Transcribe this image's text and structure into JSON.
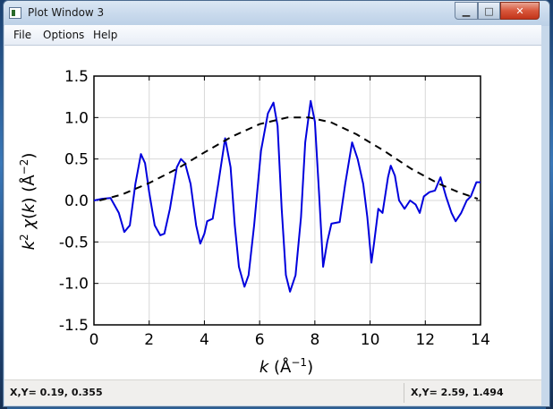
{
  "window": {
    "title": "Plot Window 3",
    "buttons": {
      "minimize": "▁",
      "maximize": "□",
      "close": "✕"
    }
  },
  "menu": [
    "File",
    "Options",
    "Help"
  ],
  "status": {
    "left": "X,Y= 0.19, 0.355",
    "right": "X,Y= 2.59, 1.494"
  },
  "chart_data": {
    "type": "line",
    "xlabel": "k (Å⁻¹)",
    "ylabel": "k² χ(k) (Å⁻²)",
    "xlim": [
      0,
      14
    ],
    "ylim": [
      -1.5,
      1.5
    ],
    "x_ticks": [
      "0",
      "2",
      "4",
      "6",
      "8",
      "10",
      "12",
      "14"
    ],
    "y_ticks": [
      "-1.5",
      "-1.0",
      "-0.5",
      "0.0",
      "0.5",
      "1.0",
      "1.5"
    ],
    "grid": true,
    "series": [
      {
        "style": "solid",
        "color": "#0000dd",
        "points": [
          [
            0.0,
            0.0
          ],
          [
            0.3,
            0.02
          ],
          [
            0.6,
            0.03
          ],
          [
            0.9,
            -0.15
          ],
          [
            1.1,
            -0.38
          ],
          [
            1.3,
            -0.3
          ],
          [
            1.5,
            0.2
          ],
          [
            1.7,
            0.56
          ],
          [
            1.85,
            0.45
          ],
          [
            2.0,
            0.1
          ],
          [
            2.2,
            -0.3
          ],
          [
            2.4,
            -0.42
          ],
          [
            2.55,
            -0.4
          ],
          [
            2.75,
            -0.1
          ],
          [
            3.0,
            0.4
          ],
          [
            3.15,
            0.5
          ],
          [
            3.3,
            0.45
          ],
          [
            3.5,
            0.2
          ],
          [
            3.7,
            -0.3
          ],
          [
            3.85,
            -0.52
          ],
          [
            4.0,
            -0.4
          ],
          [
            4.1,
            -0.25
          ],
          [
            4.3,
            -0.22
          ],
          [
            4.5,
            0.2
          ],
          [
            4.75,
            0.75
          ],
          [
            4.95,
            0.4
          ],
          [
            5.1,
            -0.3
          ],
          [
            5.25,
            -0.8
          ],
          [
            5.45,
            -1.04
          ],
          [
            5.6,
            -0.9
          ],
          [
            5.8,
            -0.3
          ],
          [
            6.05,
            0.6
          ],
          [
            6.3,
            1.05
          ],
          [
            6.5,
            1.18
          ],
          [
            6.65,
            0.9
          ],
          [
            6.8,
            -0.1
          ],
          [
            6.95,
            -0.9
          ],
          [
            7.1,
            -1.1
          ],
          [
            7.3,
            -0.9
          ],
          [
            7.5,
            -0.2
          ],
          [
            7.65,
            0.7
          ],
          [
            7.85,
            1.2
          ],
          [
            8.0,
            0.95
          ],
          [
            8.15,
            0.1
          ],
          [
            8.3,
            -0.8
          ],
          [
            8.45,
            -0.5
          ],
          [
            8.6,
            -0.28
          ],
          [
            8.9,
            -0.26
          ],
          [
            9.1,
            0.2
          ],
          [
            9.35,
            0.7
          ],
          [
            9.55,
            0.5
          ],
          [
            9.75,
            0.2
          ],
          [
            9.9,
            -0.2
          ],
          [
            10.05,
            -0.75
          ],
          [
            10.15,
            -0.5
          ],
          [
            10.3,
            -0.1
          ],
          [
            10.45,
            -0.15
          ],
          [
            10.65,
            0.28
          ],
          [
            10.75,
            0.42
          ],
          [
            10.9,
            0.3
          ],
          [
            11.05,
            0.0
          ],
          [
            11.25,
            -0.1
          ],
          [
            11.45,
            0.0
          ],
          [
            11.65,
            -0.05
          ],
          [
            11.8,
            -0.15
          ],
          [
            11.95,
            0.05
          ],
          [
            12.15,
            0.1
          ],
          [
            12.35,
            0.12
          ],
          [
            12.55,
            0.28
          ],
          [
            12.75,
            0.05
          ],
          [
            12.95,
            -0.15
          ],
          [
            13.1,
            -0.25
          ],
          [
            13.3,
            -0.15
          ],
          [
            13.5,
            0.0
          ],
          [
            13.65,
            0.05
          ],
          [
            13.85,
            0.22
          ],
          [
            14.0,
            0.22
          ]
        ]
      },
      {
        "style": "dashed",
        "color": "#000000",
        "points": [
          [
            0.2,
            0.0
          ],
          [
            1.0,
            0.07
          ],
          [
            2.0,
            0.21
          ],
          [
            3.0,
            0.38
          ],
          [
            4.0,
            0.58
          ],
          [
            5.0,
            0.77
          ],
          [
            6.0,
            0.92
          ],
          [
            7.0,
            1.0
          ],
          [
            7.8,
            1.0
          ],
          [
            8.6,
            0.94
          ],
          [
            9.5,
            0.8
          ],
          [
            10.5,
            0.6
          ],
          [
            11.5,
            0.38
          ],
          [
            12.5,
            0.2
          ],
          [
            13.2,
            0.1
          ],
          [
            13.9,
            0.02
          ]
        ]
      }
    ]
  }
}
